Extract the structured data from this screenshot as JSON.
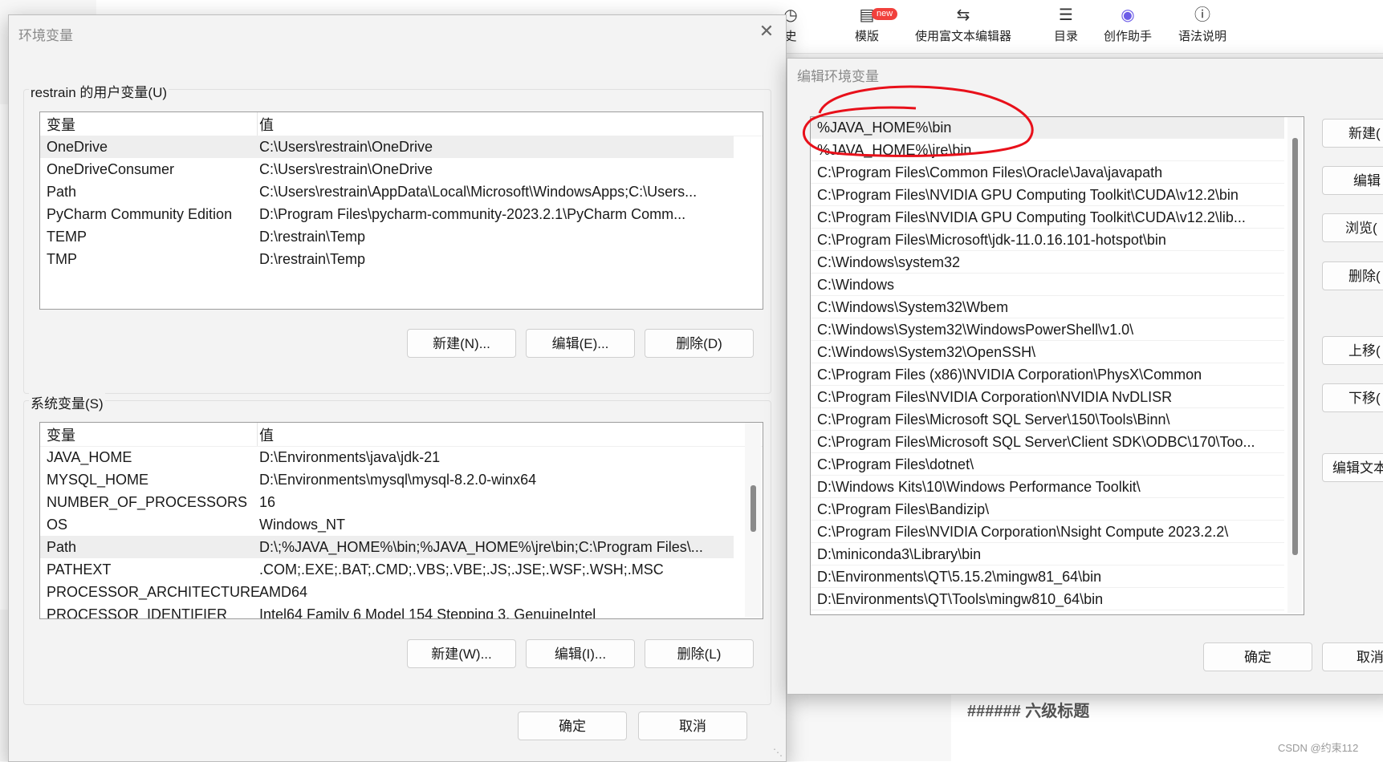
{
  "toolbar": {
    "history_partial": "史",
    "template_label": "模版",
    "new_badge": "new",
    "rich_editor_label": "使用富文本编辑器",
    "toc_label": "目录",
    "assistant_label": "创作助手",
    "syntax_label": "语法说明"
  },
  "env_dialog": {
    "title": "环境变量",
    "user_group_label": "restrain 的用户变量(U)",
    "col_variable": "变量",
    "col_value": "值",
    "user_vars": [
      {
        "name": "OneDrive",
        "value": "C:\\Users\\restrain\\OneDrive"
      },
      {
        "name": "OneDriveConsumer",
        "value": "C:\\Users\\restrain\\OneDrive"
      },
      {
        "name": "Path",
        "value": "C:\\Users\\restrain\\AppData\\Local\\Microsoft\\WindowsApps;C:\\Users..."
      },
      {
        "name": "PyCharm Community Edition",
        "value": "D:\\Program Files\\pycharm-community-2023.2.1\\PyCharm Comm..."
      },
      {
        "name": "TEMP",
        "value": "D:\\restrain\\Temp"
      },
      {
        "name": "TMP",
        "value": "D:\\restrain\\Temp"
      }
    ],
    "user_new_button": "新建(N)...",
    "user_edit_button": "编辑(E)...",
    "user_delete_button": "删除(D)",
    "system_group_label": "系统变量(S)",
    "system_vars": [
      {
        "name": "JAVA_HOME",
        "value": "D:\\Environments\\java\\jdk-21"
      },
      {
        "name": "MYSQL_HOME",
        "value": "D:\\Environments\\mysql\\mysql-8.2.0-winx64"
      },
      {
        "name": "NUMBER_OF_PROCESSORS",
        "value": "16"
      },
      {
        "name": "OS",
        "value": "Windows_NT"
      },
      {
        "name": "Path",
        "value": "D:\\;%JAVA_HOME%\\bin;%JAVA_HOME%\\jre\\bin;C:\\Program Files\\..."
      },
      {
        "name": "PATHEXT",
        "value": ".COM;.EXE;.BAT;.CMD;.VBS;.VBE;.JS;.JSE;.WSF;.WSH;.MSC"
      },
      {
        "name": "PROCESSOR_ARCHITECTURE",
        "value": "AMD64"
      },
      {
        "name": "PROCESSOR_IDENTIFIER",
        "value": "Intel64 Family 6 Model 154 Stepping 3, GenuineIntel"
      }
    ],
    "system_new_button": "新建(W)...",
    "system_edit_button": "编辑(I)...",
    "system_delete_button": "删除(L)",
    "ok_button": "确定",
    "cancel_button": "取消"
  },
  "edit_dialog": {
    "title": "编辑环境变量",
    "entries": [
      "%JAVA_HOME%\\bin",
      "%JAVA_HOME%\\jre\\bin",
      "C:\\Program Files\\Common Files\\Oracle\\Java\\javapath",
      "C:\\Program Files\\NVIDIA GPU Computing Toolkit\\CUDA\\v12.2\\bin",
      "C:\\Program Files\\NVIDIA GPU Computing Toolkit\\CUDA\\v12.2\\lib...",
      "C:\\Program Files\\Microsoft\\jdk-11.0.16.101-hotspot\\bin",
      "C:\\Windows\\system32",
      "C:\\Windows",
      "C:\\Windows\\System32\\Wbem",
      "C:\\Windows\\System32\\WindowsPowerShell\\v1.0\\",
      "C:\\Windows\\System32\\OpenSSH\\",
      "C:\\Program Files (x86)\\NVIDIA Corporation\\PhysX\\Common",
      "C:\\Program Files\\NVIDIA Corporation\\NVIDIA NvDLISR",
      "C:\\Program Files\\Microsoft SQL Server\\150\\Tools\\Binn\\",
      "C:\\Program Files\\Microsoft SQL Server\\Client SDK\\ODBC\\170\\Too...",
      "C:\\Program Files\\dotnet\\",
      "D:\\Windows Kits\\10\\Windows Performance Toolkit\\",
      "C:\\Program Files\\Bandizip\\",
      "C:\\Program Files\\NVIDIA Corporation\\Nsight Compute 2023.2.2\\",
      "D:\\miniconda3\\Library\\bin",
      "D:\\Environments\\QT\\5.15.2\\mingw81_64\\bin",
      "D:\\Environments\\QT\\Tools\\mingw810_64\\bin"
    ],
    "side_buttons": [
      "新建(",
      "编辑",
      "浏览(",
      "删除(",
      "上移(",
      "下移(",
      "编辑文本"
    ],
    "ok_button": "确定",
    "cancel_button": "取消"
  },
  "editor": {
    "heading6": "###### 六级标题",
    "watermark": "CSDN @约束112"
  },
  "colors": {
    "dialog_bg": "#f3f3f3",
    "selected_row": "#eeeeee",
    "annotation_red": "#e8101a",
    "new_badge": "#f1403c"
  }
}
